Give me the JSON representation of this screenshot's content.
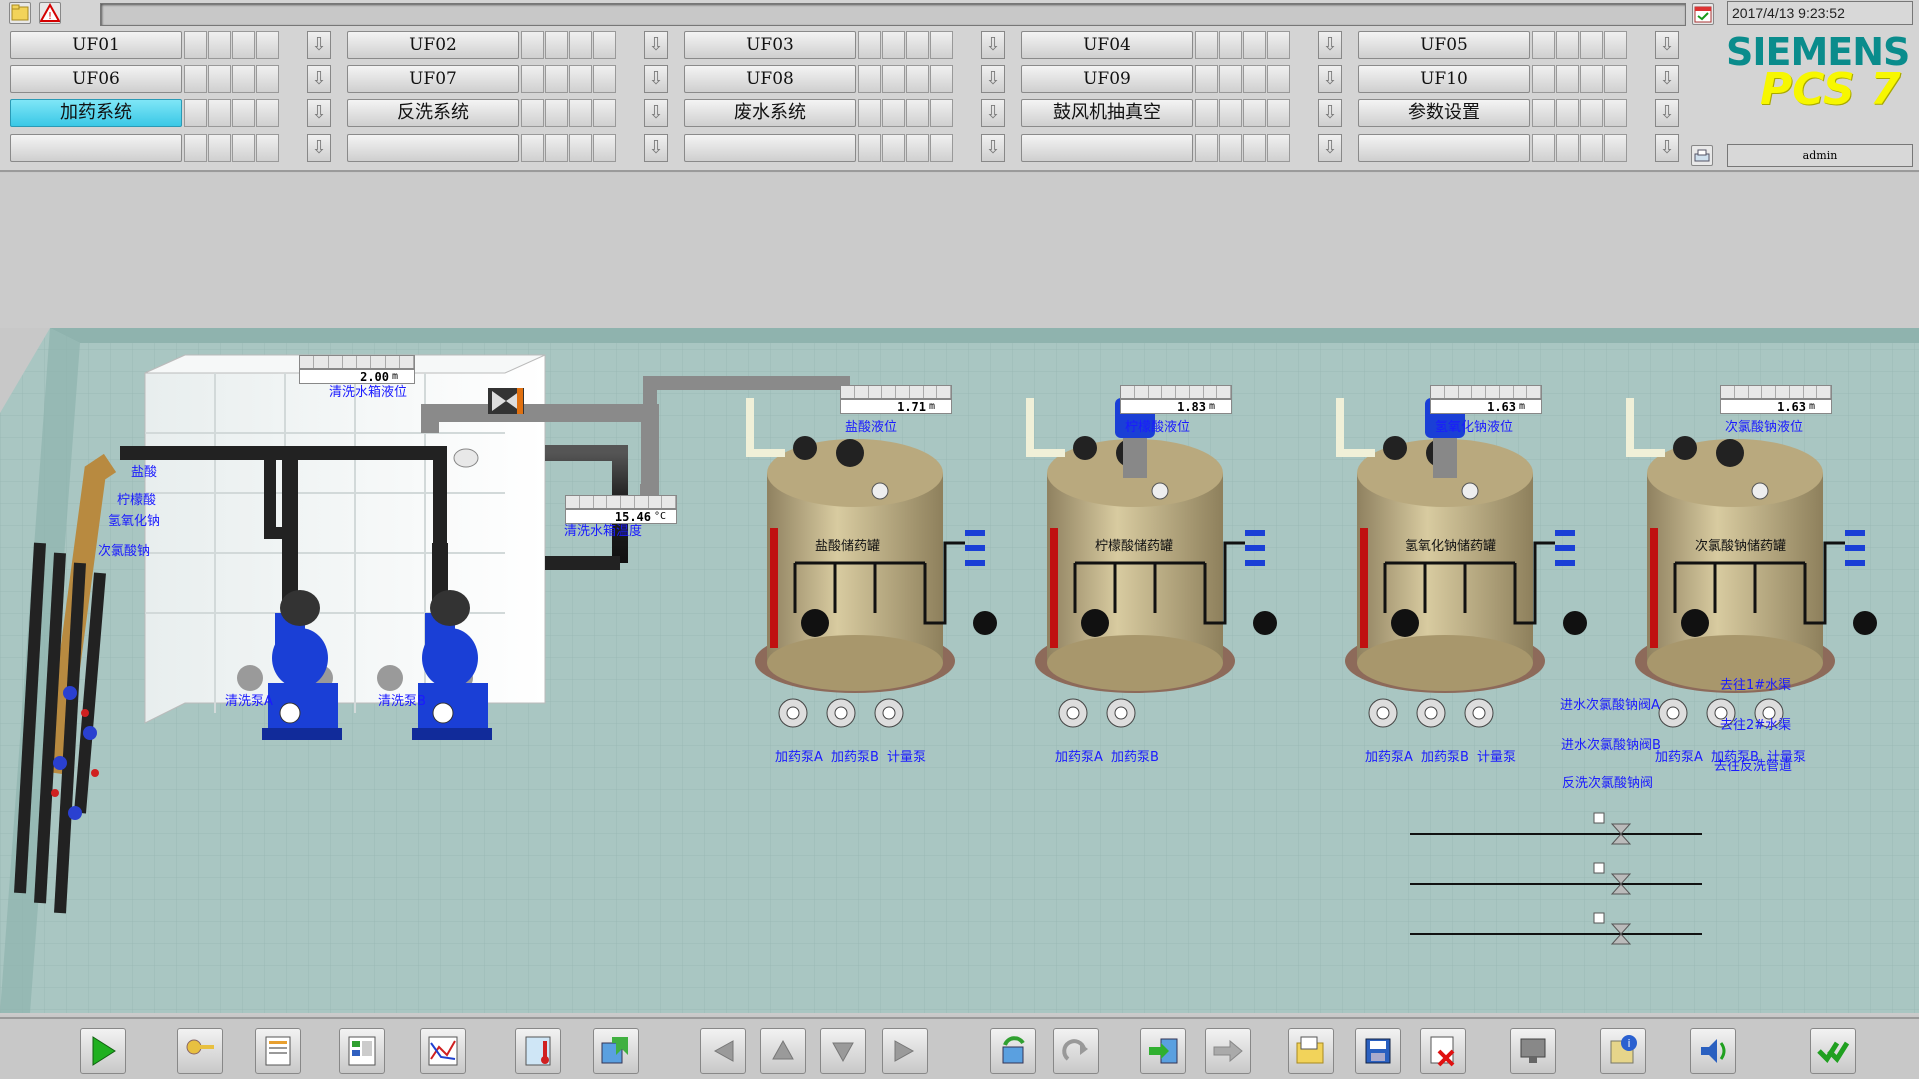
{
  "header": {
    "datetime": "2017/4/13 9:23:52",
    "user": "admin",
    "brand": "SIEMENS",
    "product": "PCS 7"
  },
  "nav": {
    "row1": [
      "UF01",
      "UF02",
      "UF03",
      "UF04",
      "UF05"
    ],
    "row2": [
      "UF06",
      "UF07",
      "UF08",
      "UF09",
      "UF10"
    ],
    "row3": [
      "加药系统",
      "反洗系统",
      "废水系统",
      "鼓风机抽真空",
      "参数设置"
    ],
    "row4": [
      "",
      "",
      "",
      "",
      ""
    ],
    "active": "加药系统"
  },
  "scene": {
    "cleaning_tank": {
      "level_value": "2.00",
      "level_unit": "m",
      "level_label": "清洗水箱液位",
      "temp_value": "15.46",
      "temp_unit": "°C",
      "temp_label": "清洗水箱温度"
    },
    "chem_lines": [
      "盐酸",
      "柠檬酸",
      "氢氧化钠",
      "次氯酸钠"
    ],
    "pumps": {
      "a": "清洗泵A",
      "b": "清洗泵B"
    },
    "tanks": [
      {
        "name": "盐酸储药罐",
        "level": "1.71",
        "unit": "m",
        "level_label": "盐酸液位",
        "pumps": [
          "加药泵A",
          "加药泵B",
          "计量泵"
        ]
      },
      {
        "name": "柠檬酸储药罐",
        "level": "1.83",
        "unit": "m",
        "level_label": "柠檬酸液位",
        "pumps": [
          "加药泵A",
          "加药泵B"
        ]
      },
      {
        "name": "氢氧化钠储药罐",
        "level": "1.63",
        "unit": "m",
        "level_label": "氢氧化钠液位",
        "pumps": [
          "加药泵A",
          "加药泵B",
          "计量泵"
        ]
      },
      {
        "name": "次氯酸钠储药罐",
        "level": "1.63",
        "unit": "m",
        "level_label": "次氯酸钠液位",
        "pumps": [
          "加药泵A",
          "加药泵B",
          "计量泵"
        ]
      }
    ],
    "valves": [
      {
        "label": "进水次氯酸钠阀A",
        "dest": "去往1#水渠"
      },
      {
        "label": "进水次氯酸钠阀B",
        "dest": "去往2#水渠"
      },
      {
        "label": "反洗次氯酸钠阀",
        "dest": "去往反洗管道"
      }
    ]
  },
  "colors": {
    "nav_active": "#3ac8e6",
    "label_blue": "#1a1aff",
    "tank_body": "#c9b98a",
    "floor": "#a9c6c2",
    "motor_blue": "#1a3fd6",
    "brand_teal": "#0a8c8c",
    "brand_yellow": "#f7f700"
  },
  "toolbar_icons": [
    "run-icon",
    "key-icon",
    "report-icon",
    "overview-icon",
    "trend-icon",
    "thermometer-icon",
    "export-icon",
    "left-arrow-icon",
    "up-arrow-icon",
    "down-arrow-icon",
    "right-arrow-icon",
    "refresh-icon",
    "redo-icon",
    "login-icon",
    "forward-icon",
    "open-folder-icon",
    "save-icon",
    "delete-icon",
    "monitor-icon",
    "info-icon",
    "alarm-sound-icon",
    "acknowledge-icon"
  ]
}
